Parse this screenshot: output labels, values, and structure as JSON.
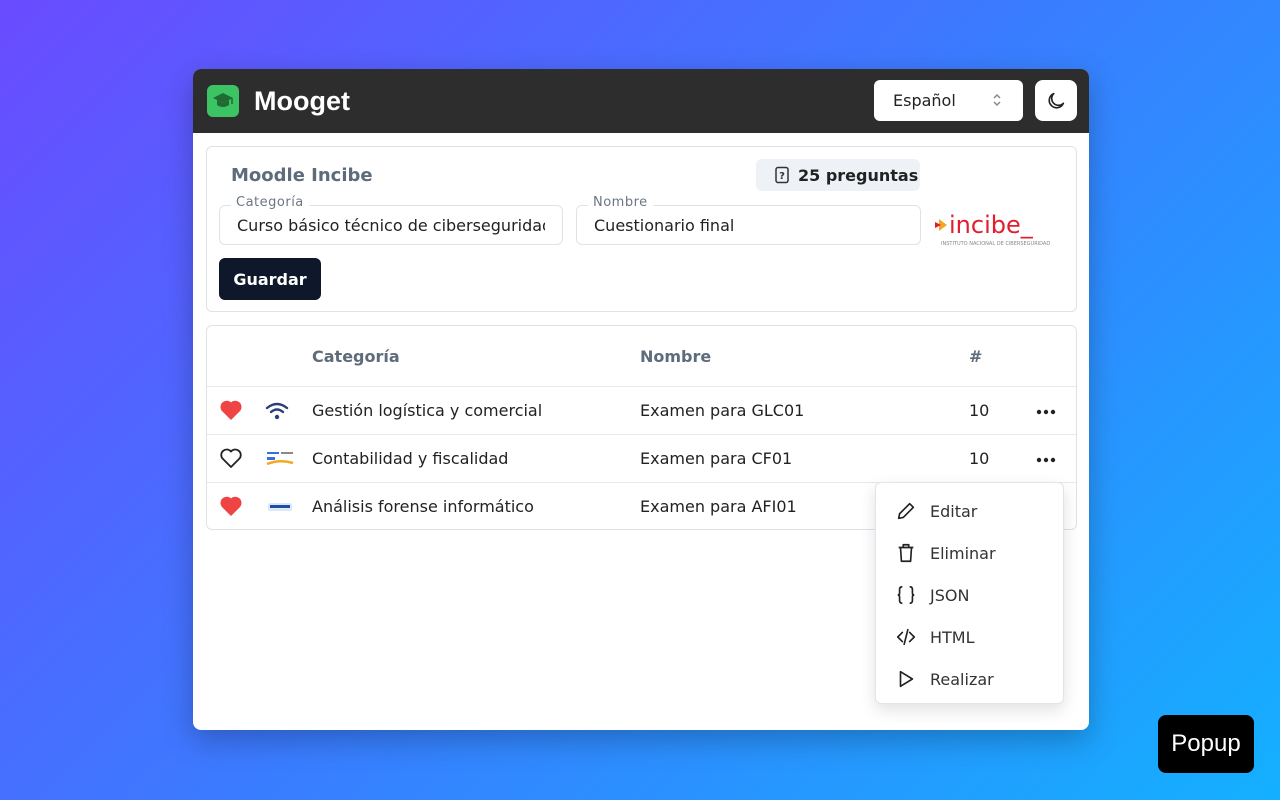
{
  "header": {
    "title": "Mooget",
    "language": "Español",
    "logo_icon": "graduation-cap-icon",
    "theme_icon": "moon-icon"
  },
  "form": {
    "source_title": "Moodle Incibe",
    "question_count": "25 preguntas",
    "category_label": "Categoría",
    "category_value": "Curso básico técnico de ciberseguridad",
    "name_label": "Nombre",
    "name_value": "Cuestionario final",
    "org_logo_text": "incibe_",
    "org_logo_subtext": "INSTITUTO NACIONAL DE CIBERSEGURIDAD",
    "save_label": "Guardar"
  },
  "table": {
    "headers": {
      "category": "Categoría",
      "name": "Nombre",
      "count": "#"
    },
    "rows": [
      {
        "favorite": true,
        "icon": "wifi-icon",
        "category": "Gestión logística y comercial",
        "name": "Examen para GLC01",
        "count": "10"
      },
      {
        "favorite": false,
        "icon": "course-logo-icon",
        "category": "Contabilidad y fiscalidad",
        "name": "Examen para CF01",
        "count": "10"
      },
      {
        "favorite": true,
        "icon": "course-logo-icon",
        "category": "Análisis forense informático",
        "name": "Examen para AFI01",
        "count": ""
      }
    ]
  },
  "menu": {
    "items": [
      {
        "label": "Editar",
        "icon": "pencil-icon"
      },
      {
        "label": "Eliminar",
        "icon": "trash-icon"
      },
      {
        "label": "JSON",
        "icon": "braces-icon"
      },
      {
        "label": "HTML",
        "icon": "code-icon"
      },
      {
        "label": "Realizar",
        "icon": "play-icon"
      }
    ]
  },
  "tag": "Popup",
  "colors": {
    "header_bg": "#2d2d2d",
    "logo_green": "#3cc464",
    "heart_red": "#ef4444",
    "button_dark": "#0f172a",
    "incibe_red": "#e11d2e"
  }
}
